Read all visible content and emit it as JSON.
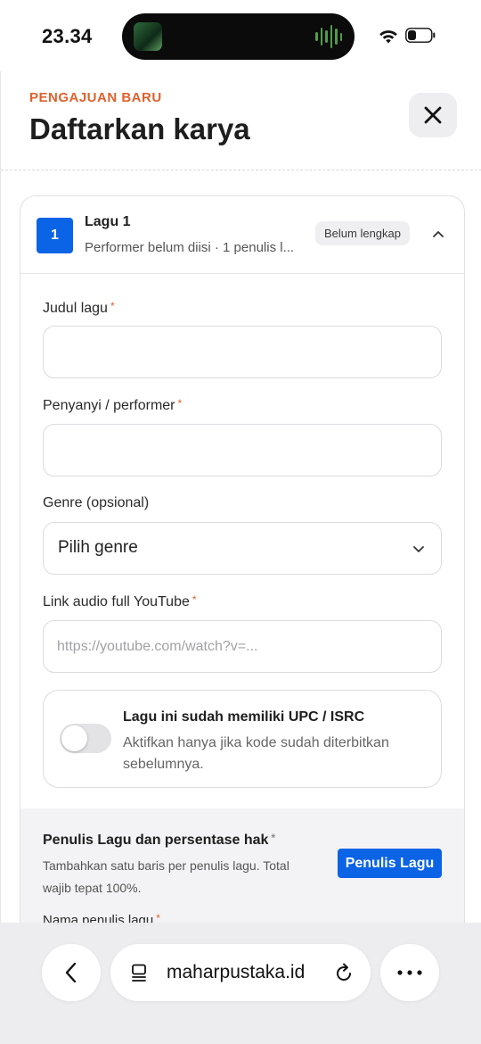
{
  "status_bar": {
    "time": "23.34",
    "icons": [
      "music-thumbnail-icon",
      "audio-wave-icon",
      "wifi-icon",
      "battery-icon"
    ]
  },
  "header": {
    "eyebrow": "PENGAJUAN BARU",
    "title": "Daftarkan karya",
    "close_icon": "close-icon"
  },
  "song_card": {
    "number": "1",
    "name": "Lagu 1",
    "meta": "Performer belum diisi · 1 penulis l...",
    "status_badge": "Belum lengkap",
    "collapse_icon": "chevron-up-icon"
  },
  "form": {
    "title_label": "Judul lagu",
    "title_value": "",
    "performer_label": "Penyanyi / performer",
    "performer_value": "",
    "genre_label": "Genre (opsional)",
    "genre_selected": "Pilih genre",
    "youtube_label": "Link audio full YouTube",
    "youtube_placeholder": "https://youtube.com/watch?v=...",
    "required_mark": "*"
  },
  "isrc_toggle": {
    "title": "Lagu ini sudah memiliki UPC / ISRC",
    "description": "Aktifkan hanya jika kode sudah diterbitkan sebelumnya.",
    "enabled": false
  },
  "writers": {
    "title": "Penulis Lagu dan persentase hak",
    "description": "Tambahkan satu baris per penulis lagu. Total wajib tepat 100%.",
    "add_button": "Penulis Lagu",
    "name_label": "Nama penulis lagu"
  },
  "browser": {
    "url": "maharpustaka.id",
    "icons": [
      "back-arrow-icon",
      "reader-icon",
      "reload-icon",
      "more-icon"
    ]
  },
  "colors": {
    "accent_orange": "#e0612c",
    "primary_blue": "#0b63e5"
  }
}
